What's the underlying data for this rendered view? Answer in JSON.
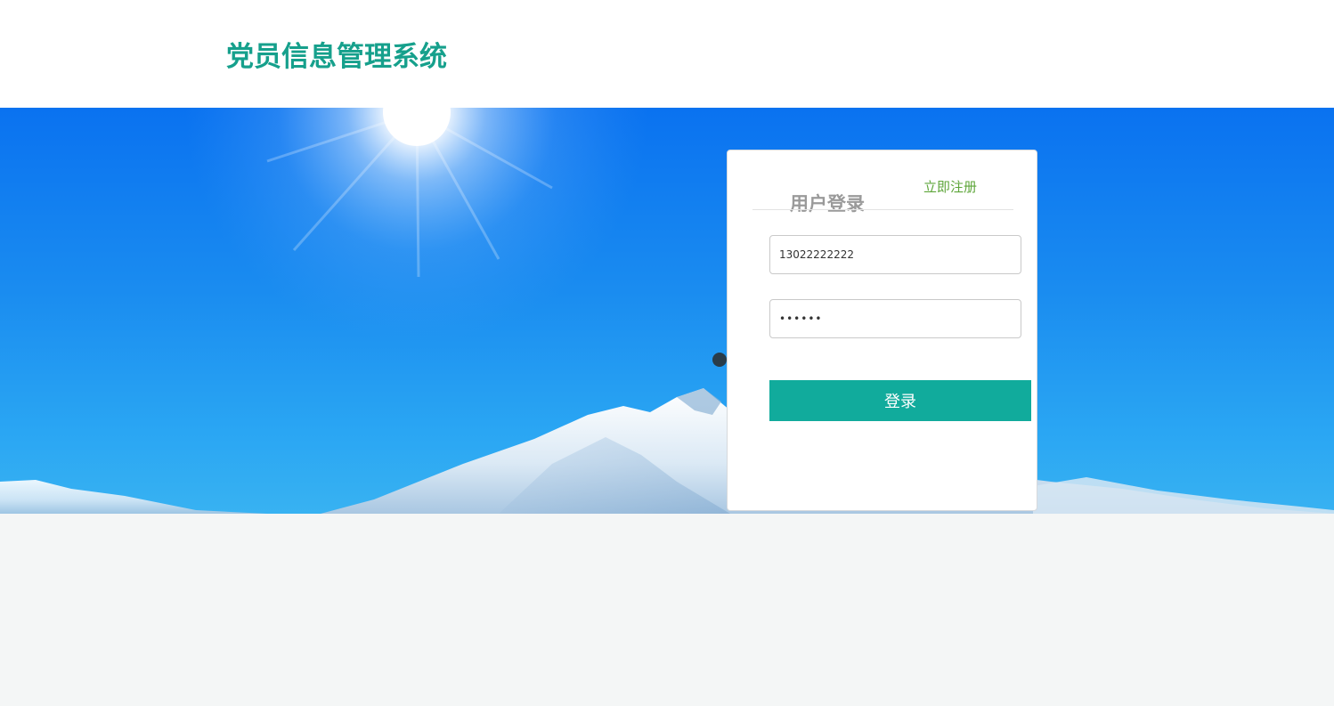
{
  "header": {
    "site_title": "党员信息管理系统"
  },
  "login": {
    "title": "用户登录",
    "register_link": "立即注册",
    "phone_value": "13022222222",
    "password_value": "••••••",
    "submit_label": "登录"
  },
  "colors": {
    "brand_teal": "#16a08c",
    "button_teal": "#11ab9c",
    "register_green": "#5ea63a",
    "sky_blue": "#1a8cf0",
    "page_background": "#f4f6f6"
  }
}
